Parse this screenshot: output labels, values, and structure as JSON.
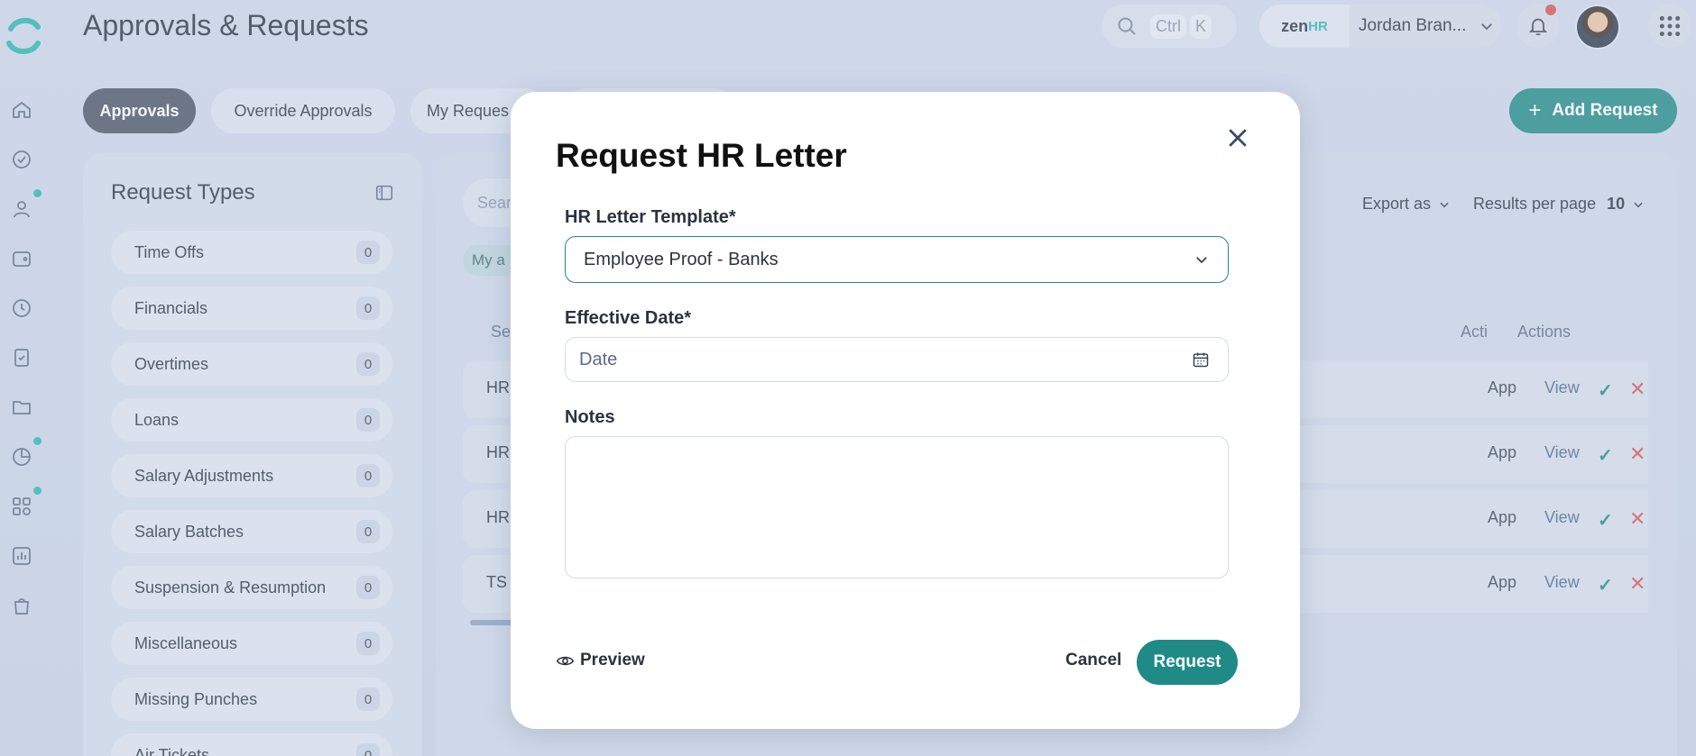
{
  "header": {
    "title": "Approvals & Requests",
    "search_key1": "Ctrl",
    "search_key2": "K",
    "brand_zen": "zen",
    "brand_hr": "HR",
    "user_name": "Jordan Bran..."
  },
  "tabs": [
    {
      "label": "Approvals",
      "active": true
    },
    {
      "label": "Override Approvals",
      "active": false
    },
    {
      "label": "My Reques",
      "active": false
    }
  ],
  "add_request_label": "Add Request",
  "request_types": {
    "title": "Request Types",
    "items": [
      {
        "label": "Time Offs",
        "count": "0"
      },
      {
        "label": "Financials",
        "count": "0"
      },
      {
        "label": "Overtimes",
        "count": "0"
      },
      {
        "label": "Loans",
        "count": "0"
      },
      {
        "label": "Salary Adjustments",
        "count": "0"
      },
      {
        "label": "Salary Batches",
        "count": "0"
      },
      {
        "label": "Suspension & Resumption",
        "count": "0"
      },
      {
        "label": "Miscellaneous",
        "count": "0"
      },
      {
        "label": "Missing Punches",
        "count": "0"
      },
      {
        "label": "Air Tickets",
        "count": "0"
      }
    ]
  },
  "table": {
    "search_placeholder": "Sear",
    "chip": "My a",
    "export_label": "Export as",
    "per_page_label": "Results per page",
    "per_page_value": "10",
    "headers": {
      "first": "Se",
      "acti": "Acti",
      "actions": "Actions"
    },
    "rows": [
      {
        "key": "HR",
        "status": "App",
        "view": "View"
      },
      {
        "key": "HR",
        "status": "App",
        "view": "View"
      },
      {
        "key": "HR",
        "status": "App",
        "view": "View"
      },
      {
        "key": "TS",
        "status": "App",
        "view": "View"
      }
    ]
  },
  "modal": {
    "title": "Request HR Letter",
    "template_label": "HR Letter Template*",
    "template_value": "Employee Proof - Banks",
    "date_label": "Effective Date*",
    "date_placeholder": "Date",
    "notes_label": "Notes",
    "notes_value": "",
    "preview_label": "Preview",
    "cancel_label": "Cancel",
    "request_label": "Request"
  },
  "colors": {
    "accent": "#1f8a86",
    "danger": "#d9534f",
    "active_tab": "#4a5566"
  }
}
